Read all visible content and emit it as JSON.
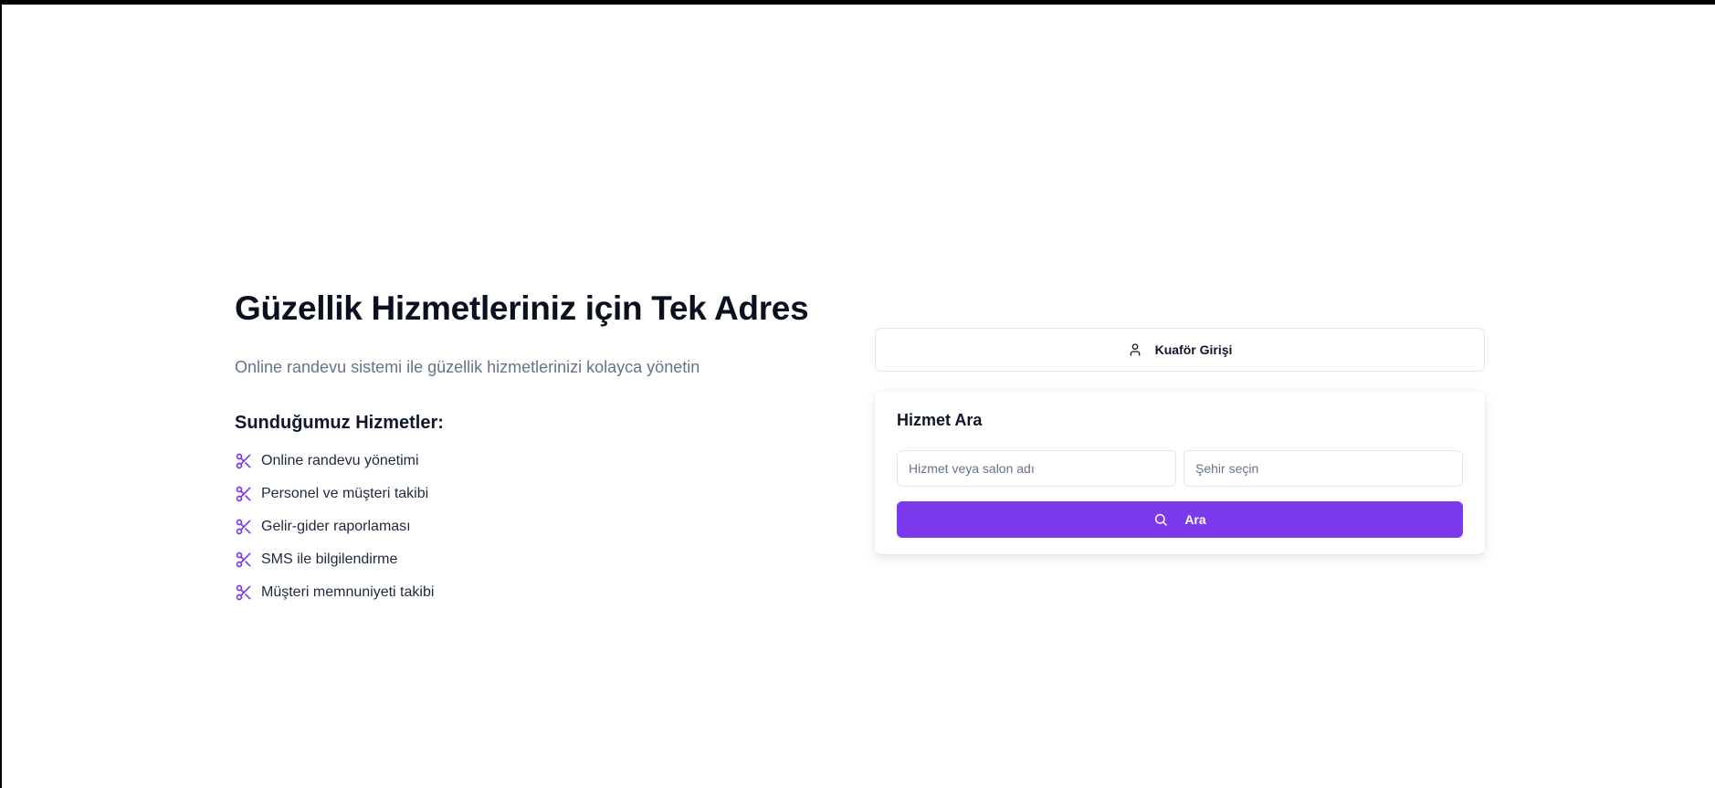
{
  "hero": {
    "title": "Güzellik Hizmetleriniz için Tek Adres",
    "subtitle": "Online randevu sistemi ile güzellik hizmetlerinizi kolayca yönetin"
  },
  "services": {
    "heading": "Sunduğumuz Hizmetler:",
    "icon": "scissors-icon",
    "items": [
      "Online randevu yönetimi",
      "Personel ve müşteri takibi",
      "Gelir-gider raporlaması",
      "SMS ile bilgilendirme",
      "Müşteri memnuniyeti takibi"
    ]
  },
  "login": {
    "label": "Kuaför Girişi",
    "icon": "user-icon"
  },
  "search": {
    "title": "Hizmet Ara",
    "service_placeholder": "Hizmet veya salon adı",
    "city_placeholder": "Şehir seçin",
    "button_label": "Ara",
    "button_icon": "search-icon"
  },
  "colors": {
    "accent": "#7c3aed",
    "muted_text": "#64748b",
    "border": "#e2e8f0"
  }
}
